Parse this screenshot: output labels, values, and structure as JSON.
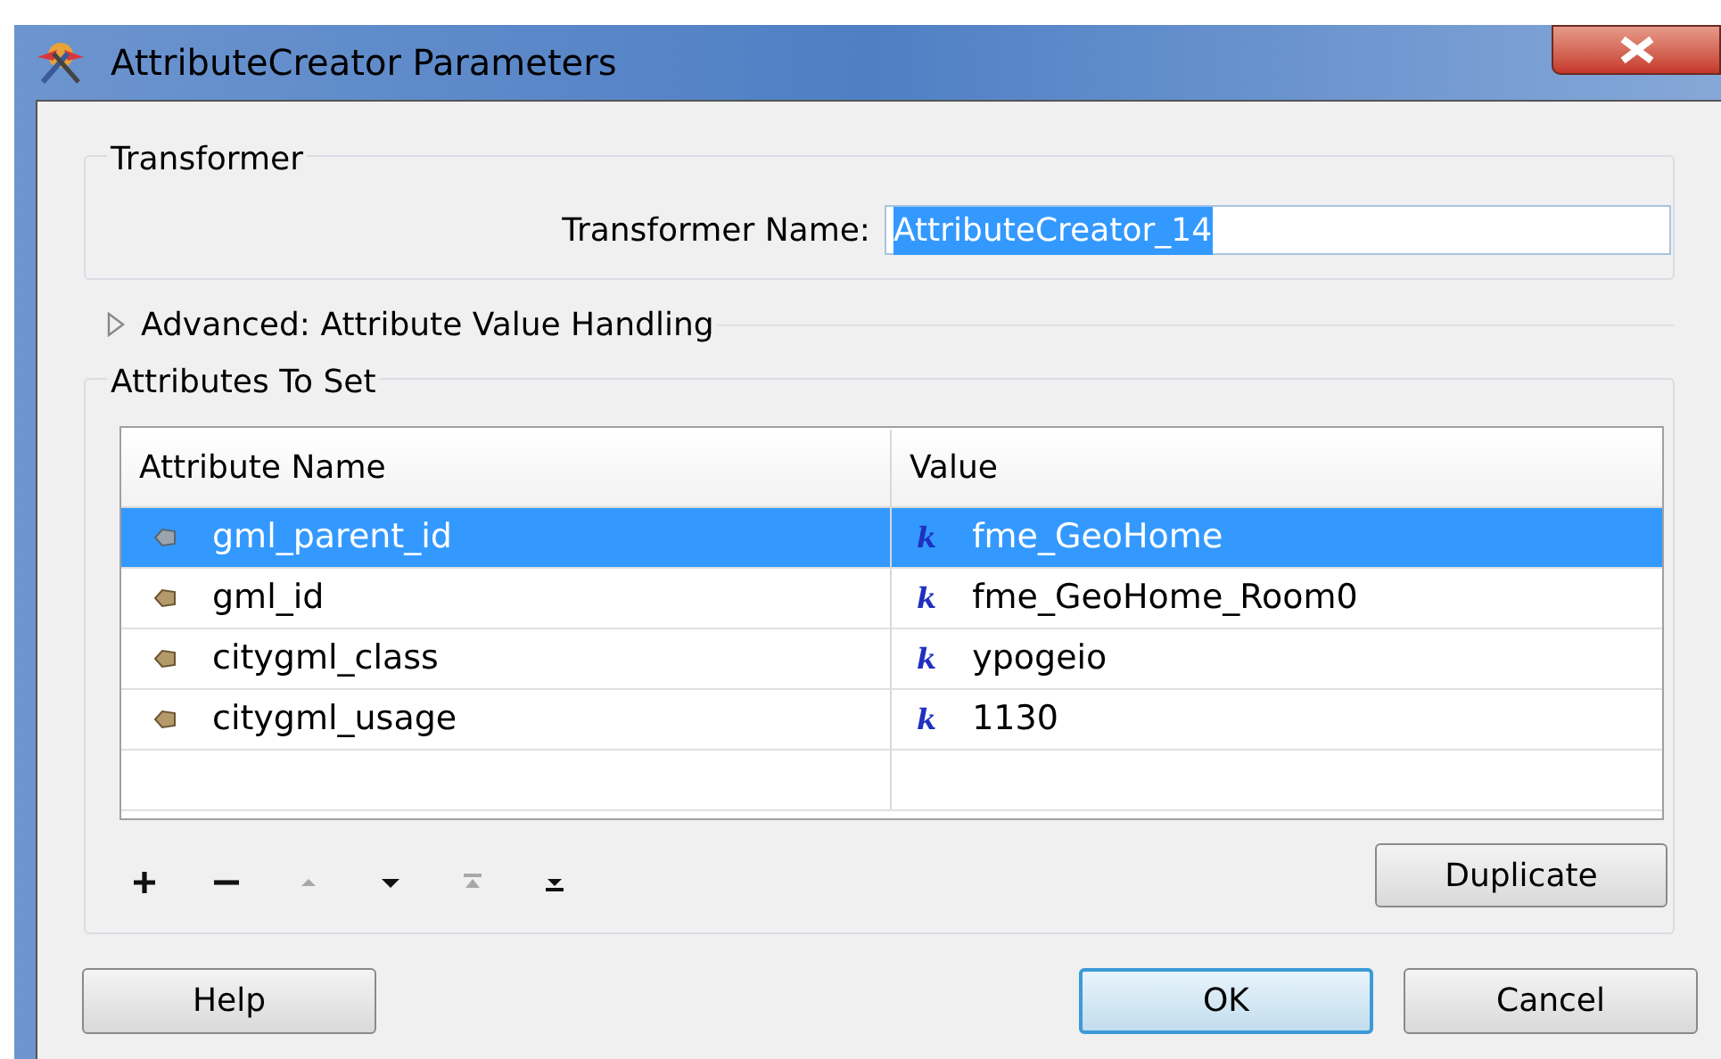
{
  "window": {
    "title": "AttributeCreator Parameters"
  },
  "transformer_group": {
    "title": "Transformer",
    "name_label": "Transformer Name:",
    "name_value": "AttributeCreator_14",
    "value_selected": true
  },
  "advanced_section": {
    "label": "Advanced: Attribute Value Handling",
    "expanded": false
  },
  "attributes_group": {
    "title": "Attributes To Set",
    "table": {
      "columns": [
        "Attribute Name",
        "Value"
      ],
      "rows": [
        {
          "name": "gml_parent_id",
          "type_icon": "k",
          "value": "fme_GeoHome",
          "selected": true
        },
        {
          "name": "gml_id",
          "type_icon": "k",
          "value": "fme_GeoHome_Room0",
          "selected": false
        },
        {
          "name": "citygml_class",
          "type_icon": "k",
          "value": "ypogeio",
          "selected": false
        },
        {
          "name": "citygml_usage",
          "type_icon": "k",
          "value": "1130",
          "selected": false
        }
      ]
    },
    "toolbar": [
      {
        "kind": "add",
        "disabled": false
      },
      {
        "kind": "remove",
        "disabled": false
      },
      {
        "kind": "up",
        "disabled": true
      },
      {
        "kind": "down",
        "disabled": false
      },
      {
        "kind": "top",
        "disabled": true
      },
      {
        "kind": "bottom",
        "disabled": false
      }
    ],
    "duplicate_button": "Duplicate"
  },
  "buttons": [
    {
      "label": "Help",
      "default": false
    },
    {
      "label": "OK",
      "default": true
    },
    {
      "label": "Cancel",
      "default": false
    }
  ]
}
